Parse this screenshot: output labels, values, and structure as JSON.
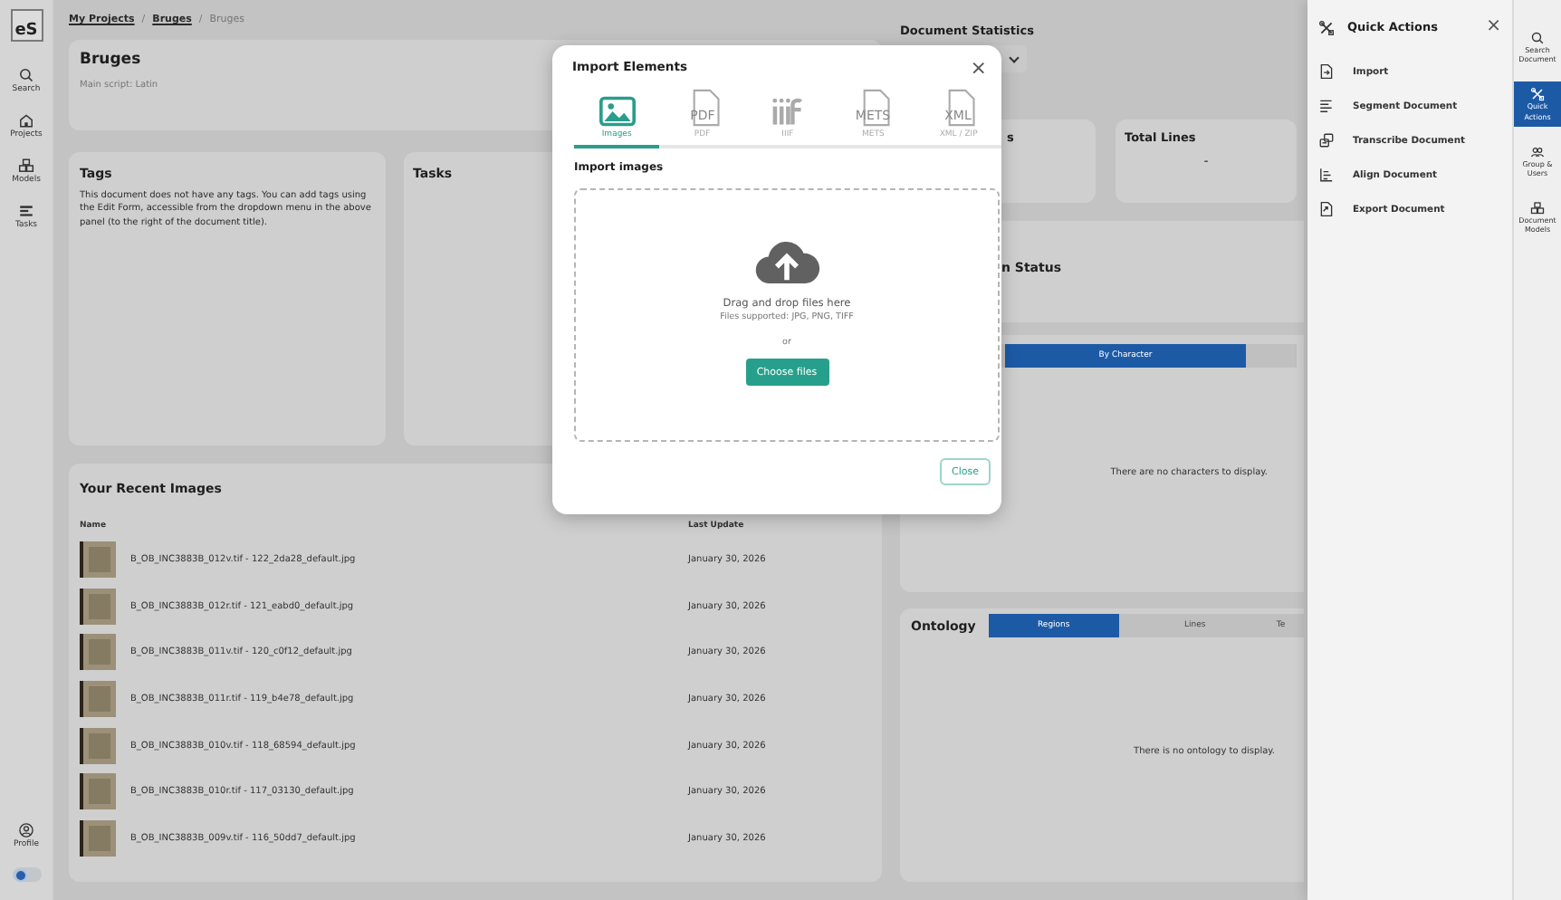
{
  "sidebar": {
    "logo": "eS",
    "items": [
      {
        "label": "Search",
        "kind": "search"
      },
      {
        "label": "Projects",
        "kind": "house"
      },
      {
        "label": "Models",
        "kind": "cubes"
      },
      {
        "label": "Tasks",
        "kind": "list"
      }
    ],
    "profile": {
      "label": "Profile"
    },
    "theme_toggle": {
      "on": false
    }
  },
  "breadcrumb": [
    {
      "label": "My Projects",
      "current": false
    },
    {
      "separator": "/",
      "label": "Bruges",
      "current": false
    },
    {
      "separator": "/",
      "label": "Bruges",
      "current": true
    }
  ],
  "document": {
    "title": "Bruges",
    "subtitle": "Main script: Latin"
  },
  "tags": {
    "title": "Tags",
    "text": "This document does not have any tags. You can add tags using the Edit Form, accessible from the dropdown menu in the above panel (to the right of the document title)."
  },
  "tasks": {
    "title": "Tasks"
  },
  "recent_images": {
    "title": "Your Recent Images",
    "columns": [
      "Name",
      "Last Update"
    ],
    "rows": [
      {
        "name": "B_OB_INC3883B_012v.tif - 122_2da28_default.jpg",
        "date": "January 30, 2026"
      },
      {
        "name": "B_OB_INC3883B_012r.tif - 121_eabd0_default.jpg",
        "date": "January 30, 2026"
      },
      {
        "name": "B_OB_INC3883B_011v.tif - 120_c0f12_default.jpg",
        "date": "January 30, 2026"
      },
      {
        "name": "B_OB_INC3883B_011r.tif - 119_b4e78_default.jpg",
        "date": "January 30, 2026"
      },
      {
        "name": "B_OB_INC3883B_010v.tif - 118_68594_default.jpg",
        "date": "January 30, 2026"
      },
      {
        "name": "B_OB_INC3883B_010r.tif - 117_03130_default.jpg",
        "date": "January 30, 2026"
      },
      {
        "name": "B_OB_INC3883B_009v.tif - 116_50dd7_default.jpg",
        "date": "January 30, 2026"
      }
    ]
  },
  "statistics": {
    "title": "Document Statistics",
    "cards": [
      {
        "title": "s"
      },
      {
        "title": "Total Lines",
        "value": "-"
      }
    ]
  },
  "status": {
    "title": "n Status"
  },
  "characters": {
    "tabs": [
      {
        "label": "By Character",
        "selected": true
      }
    ],
    "empty": "There are no characters to display."
  },
  "ontology": {
    "title": "Ontology",
    "tabs": [
      {
        "label": "Regions",
        "selected": true
      },
      {
        "label": "Lines",
        "selected": false
      },
      {
        "label": "Te",
        "selected": false
      }
    ],
    "empty": "There is no ontology to display."
  },
  "modal": {
    "title": "Import Elements",
    "close": "×",
    "tabs": [
      {
        "label": "Images",
        "kind": "image",
        "selected": true
      },
      {
        "label": "PDF",
        "kind": "file",
        "icon_text": "PDF",
        "selected": false
      },
      {
        "label": "IIIF",
        "kind": "iiif",
        "selected": false
      },
      {
        "label": "METS",
        "kind": "file",
        "icon_text": "METS",
        "selected": false
      },
      {
        "label": "XML / ZIP",
        "kind": "file",
        "icon_text": "XML",
        "selected": false
      }
    ],
    "section": "Import images",
    "dropzone": {
      "heading": "Drag and drop files here",
      "hint": "Files supported: JPG, PNG, TIFF",
      "separator": "or",
      "button": "Choose files"
    },
    "close_button": "Close"
  },
  "quick_actions": {
    "title": "Quick Actions",
    "close": "×",
    "items": [
      {
        "label": "Import",
        "kind": "import"
      },
      {
        "label": "Segment Document",
        "kind": "lines"
      },
      {
        "label": "Transcribe Document",
        "kind": "transcribe"
      },
      {
        "label": "Align Document",
        "kind": "align"
      },
      {
        "label": "Export Document",
        "kind": "export"
      }
    ]
  },
  "right_rail": [
    {
      "label": "Search Document",
      "kind": "search",
      "selected": false
    },
    {
      "label": "Quick Actions",
      "kind": "tools",
      "selected": true
    },
    {
      "label": "Group & Users",
      "kind": "users",
      "selected": false
    },
    {
      "label": "Document Models",
      "kind": "cubes",
      "selected": false
    }
  ]
}
